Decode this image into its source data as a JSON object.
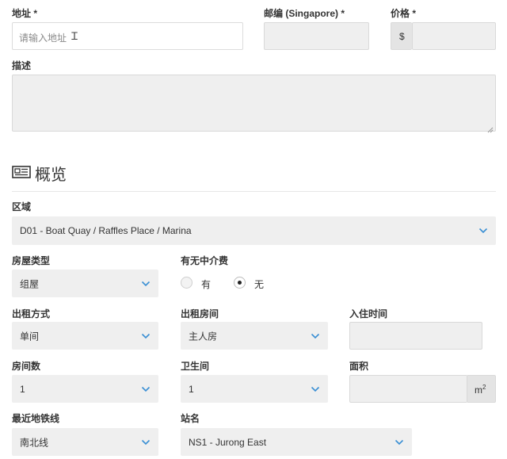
{
  "address": {
    "label": "地址 *",
    "placeholder": "请输入地址"
  },
  "postal": {
    "label": "邮编 (Singapore) *",
    "value": ""
  },
  "price": {
    "label": "价格 *",
    "prefix": "$",
    "value": ""
  },
  "description": {
    "label": "描述",
    "value": ""
  },
  "overview": {
    "title": "概览",
    "icon": "newspaper-icon"
  },
  "district": {
    "label": "区域",
    "selected": "D01 - Boat Quay / Raffles Place / Marina"
  },
  "property_type": {
    "label": "房屋类型",
    "selected": "组屋"
  },
  "agent_fee": {
    "label": "有无中介费",
    "options": [
      "有",
      "无"
    ],
    "selected": "无"
  },
  "rent_type": {
    "label": "出租方式",
    "selected": "单间"
  },
  "room_type": {
    "label": "出租房间",
    "selected": "主人房"
  },
  "move_in": {
    "label": "入住时间",
    "value": ""
  },
  "rooms": {
    "label": "房间数",
    "selected": "1"
  },
  "bathrooms": {
    "label": "卫生间",
    "selected": "1"
  },
  "area": {
    "label": "面积",
    "unit_base": "m",
    "unit_exp": "2",
    "value": ""
  },
  "mrt_line": {
    "label": "最近地铁线",
    "selected": "南北线"
  },
  "station": {
    "label": "站名",
    "selected": "NS1 - Jurong East"
  },
  "colors": {
    "chevron": "#3a8fd4",
    "field": "#efefef",
    "label": "#333333"
  }
}
